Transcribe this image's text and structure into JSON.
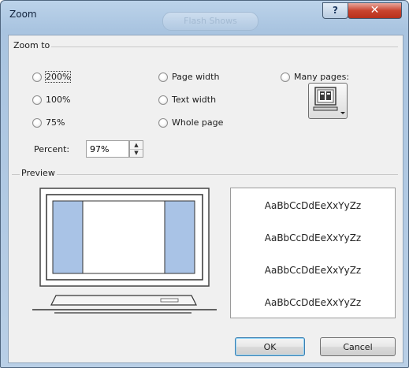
{
  "window": {
    "title": "Zoom",
    "background_tab_label": "Flash Shows"
  },
  "titlebar": {
    "help_glyph": "?",
    "close_glyph": "✕"
  },
  "zoom_to": {
    "group_label": "Zoom to",
    "options": [
      {
        "label": "200%",
        "selected": false
      },
      {
        "label": "100%",
        "selected": false
      },
      {
        "label": "75%",
        "selected": false
      },
      {
        "label": "Page width",
        "selected": false
      },
      {
        "label": "Text width",
        "selected": false
      },
      {
        "label": "Whole page",
        "selected": false
      },
      {
        "label": "Many pages:",
        "selected": false
      }
    ],
    "many_pages_icon": "monitor-pages-icon"
  },
  "percent": {
    "label": "Percent:",
    "value": "97%"
  },
  "preview": {
    "group_label": "Preview",
    "samples": [
      "AaBbCcDdEeXxYyZz",
      "AaBbCcDdEeXxYyZz",
      "AaBbCcDdEeXxYyZz",
      "AaBbCcDdEeXxYyZz"
    ]
  },
  "buttons": {
    "ok": "OK",
    "cancel": "Cancel"
  },
  "colors": {
    "page_margin_fill": "#a9c3e6",
    "titlebar": "#b9cfe6",
    "close_button": "#c9442f"
  }
}
